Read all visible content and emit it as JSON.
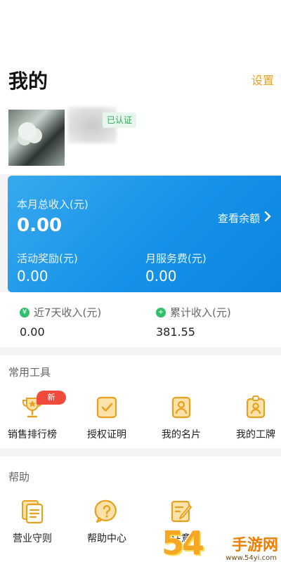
{
  "header": {
    "title": "我的",
    "settings_label": "设置"
  },
  "profile": {
    "verified_label": "已认证"
  },
  "income_card": {
    "month_income_label": "本月总收入(元)",
    "month_income_value": "0.00",
    "balance_link_label": "查看余额",
    "activity_bonus_label": "活动奖励(元)",
    "activity_bonus_value": "0.00",
    "service_fee_label": "月服务费(元)",
    "service_fee_value": "0.00"
  },
  "stats": {
    "last7_label": "近7天收入(元)",
    "last7_value": "0.00",
    "total_label": "累计收入(元)",
    "total_value": "381.55"
  },
  "tools": {
    "title": "常用工具",
    "new_badge": "新",
    "items": [
      {
        "label": "销售排行榜",
        "icon": "trophy-icon"
      },
      {
        "label": "授权证明",
        "icon": "certificate-icon"
      },
      {
        "label": "我的名片",
        "icon": "business-card-icon"
      },
      {
        "label": "我的工牌",
        "icon": "badge-icon"
      }
    ]
  },
  "help": {
    "title": "帮助",
    "items": [
      {
        "label": "营业守则",
        "icon": "rules-document-icon"
      },
      {
        "label": "帮助中心",
        "icon": "help-center-icon"
      },
      {
        "label": "注意",
        "icon": "edit-note-icon"
      }
    ]
  },
  "watermark": {
    "number": "54",
    "site_text": "手游网",
    "url": "www.54yi.com"
  },
  "colors": {
    "accent": "#e8a020",
    "card_blue": "#1592e8",
    "green": "#2fbf6b",
    "badge_red": "#ef4a3c"
  }
}
